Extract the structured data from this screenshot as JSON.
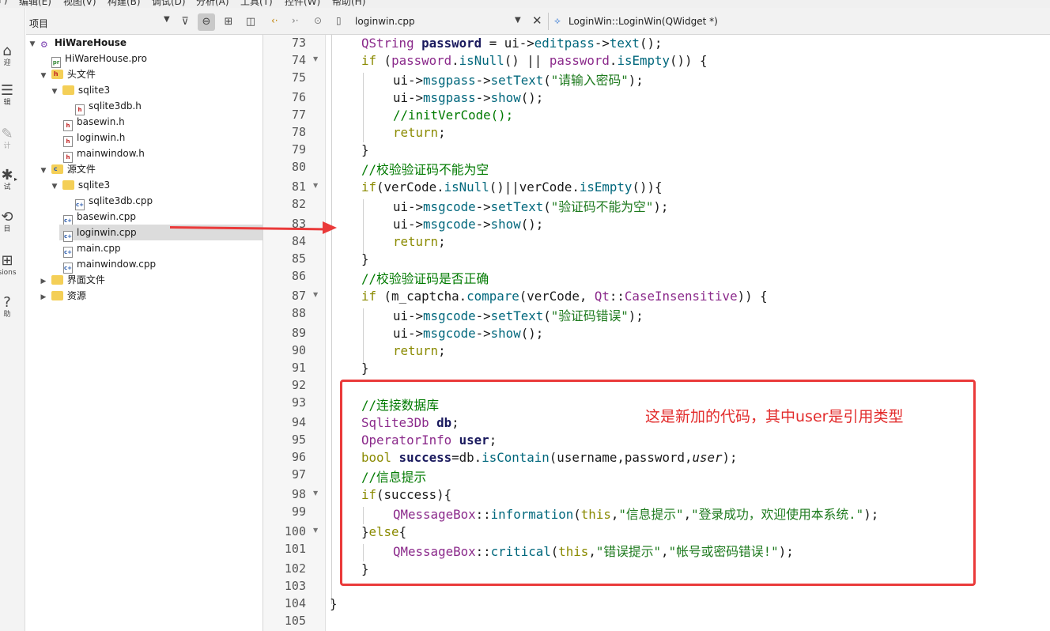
{
  "menu": [
    "F)",
    "编辑(E)",
    "视图(V)",
    "构建(B)",
    "调试(D)",
    "分析(A)",
    "工具(T)",
    "控件(W)",
    "帮助(H)"
  ],
  "modes": [
    {
      "icon": "welcome-icon",
      "label": "迎"
    },
    {
      "icon": "edit-icon",
      "label": "辑"
    },
    {
      "icon": "design-icon",
      "label": "计"
    },
    {
      "icon": "debug-icon",
      "label": "试"
    },
    {
      "icon": "projects-icon",
      "label": "目"
    },
    {
      "icon": "extensions-icon",
      "label": "sions"
    },
    {
      "icon": "help-icon",
      "label": "助"
    }
  ],
  "project_panel": {
    "title": "项目",
    "tree": [
      {
        "label": "HiWareHouse",
        "type": "project",
        "depth": 0,
        "expanded": true
      },
      {
        "label": "HiWareHouse.pro",
        "type": "pro",
        "depth": 1
      },
      {
        "label": "头文件",
        "type": "folder-h",
        "depth": 1,
        "expanded": true
      },
      {
        "label": "sqlite3",
        "type": "folder",
        "depth": 2,
        "expanded": true
      },
      {
        "label": "sqlite3db.h",
        "type": "h",
        "depth": 3
      },
      {
        "label": "basewin.h",
        "type": "h",
        "depth": 2
      },
      {
        "label": "loginwin.h",
        "type": "h",
        "depth": 2
      },
      {
        "label": "mainwindow.h",
        "type": "h",
        "depth": 2
      },
      {
        "label": "源文件",
        "type": "folder-c",
        "depth": 1,
        "expanded": true
      },
      {
        "label": "sqlite3",
        "type": "folder",
        "depth": 2,
        "expanded": true
      },
      {
        "label": "sqlite3db.cpp",
        "type": "cpp",
        "depth": 3
      },
      {
        "label": "basewin.cpp",
        "type": "cpp",
        "depth": 2
      },
      {
        "label": "loginwin.cpp",
        "type": "cpp",
        "depth": 2,
        "selected": true
      },
      {
        "label": "main.cpp",
        "type": "cpp",
        "depth": 2
      },
      {
        "label": "mainwindow.cpp",
        "type": "cpp",
        "depth": 2
      },
      {
        "label": "界面文件",
        "type": "folder-ui",
        "depth": 1,
        "expanded": false
      },
      {
        "label": "资源",
        "type": "folder-res",
        "depth": 1,
        "expanded": false
      }
    ]
  },
  "editor": {
    "file_name": "loginwin.cpp",
    "symbol": "LoginWin::LoginWin(QWidget *)",
    "line_numbers": [
      "73",
      "74",
      "75",
      "76",
      "77",
      "78",
      "79",
      "80",
      "81",
      "82",
      "83",
      "84",
      "85",
      "86",
      "87",
      "88",
      "89",
      "90",
      "91",
      "92",
      "93",
      "94",
      "95",
      "96",
      "97",
      "98",
      "99",
      "100",
      "101",
      "102",
      "103",
      "104",
      "105"
    ],
    "code": {
      "l73a": "QString",
      "l73b": "password",
      "l73c": " = ui->",
      "l73d": "editpass",
      "l73e": "->",
      "l73f": "text",
      "l73g": "();",
      "l74a": "if",
      "l74b": " (",
      "l74c": "password",
      "l74d": ".",
      "l74e": "isNull",
      "l74f": "() || ",
      "l74g": "password",
      "l74h": ".",
      "l74i": "isEmpty",
      "l74j": "()) {",
      "l75a": "ui->",
      "l75b": "msgpass",
      "l75c": "->",
      "l75d": "setText",
      "l75e": "(",
      "l75f": "\"请输入密码\"",
      "l75g": ");",
      "l76a": "ui->",
      "l76b": "msgpass",
      "l76c": "->",
      "l76d": "show",
      "l76e": "();",
      "l77": "//initVerCode();",
      "l78a": "return",
      "l78b": ";",
      "l79": "}",
      "l80": "//校验验证码不能为空",
      "l81a": "if",
      "l81b": "(verCode.",
      "l81c": "isNull",
      "l81d": "()||verCode.",
      "l81e": "isEmpty",
      "l81f": "()){",
      "l82a": "ui->",
      "l82b": "msgcode",
      "l82c": "->",
      "l82d": "setText",
      "l82e": "(",
      "l82f": "\"验证码不能为空\"",
      "l82g": ");",
      "l83a": "ui->",
      "l83b": "msgcode",
      "l83c": "->",
      "l83d": "show",
      "l83e": "();",
      "l84a": "return",
      "l84b": ";",
      "l85": "}",
      "l86": "//校验验证码是否正确",
      "l87a": "if",
      "l87b": " (m_captcha.",
      "l87c": "compare",
      "l87d": "(verCode, ",
      "l87e": "Qt",
      "l87f": "::",
      "l87g": "CaseInsensitive",
      "l87h": ")) {",
      "l88a": "ui->",
      "l88b": "msgcode",
      "l88c": "->",
      "l88d": "setText",
      "l88e": "(",
      "l88f": "\"验证码错误\"",
      "l88g": ");",
      "l89a": "ui->",
      "l89b": "msgcode",
      "l89c": "->",
      "l89d": "show",
      "l89e": "();",
      "l90a": "return",
      "l90b": ";",
      "l91": "}",
      "l93": "//连接数据库",
      "l94a": "Sqlite3Db",
      "l94b": " db",
      "l94c": ";",
      "l95a": "OperatorInfo",
      "l95b": " user",
      "l95c": ";",
      "l96a": "bool",
      "l96b": " success",
      "l96c": "=db.",
      "l96d": "isContain",
      "l96e": "(username,password,",
      "l96f": "user",
      "l96g": ");",
      "l97": "//信息提示",
      "l98a": "if",
      "l98b": "(success){",
      "l99a": "QMessageBox",
      "l99b": "::",
      "l99c": "information",
      "l99d": "(",
      "l99e": "this",
      "l99f": ",",
      "l99g": "\"信息提示\"",
      "l99h": ",",
      "l99i": "\"登录成功，欢迎使用本系统.\"",
      "l99j": ");",
      "l100a": "}",
      "l100b": "else",
      "l100c": "{",
      "l101a": "QMessageBox",
      "l101b": "::",
      "l101c": "critical",
      "l101d": "(",
      "l101e": "this",
      "l101f": ",",
      "l101g": "\"错误提示\"",
      "l101h": ",",
      "l101i": "\"帐号或密码错误!\"",
      "l101j": ");",
      "l102": "}",
      "l104": "}"
    }
  },
  "annotation": {
    "note": "这是新加的代码，其中user是引用类型",
    "color": "#ea3a3a"
  },
  "colors": {
    "keyword": "#8a8a00",
    "type": "#8b2a8b",
    "function": "#00677c",
    "string": "#1e7a1e",
    "comment": "#007a00"
  }
}
